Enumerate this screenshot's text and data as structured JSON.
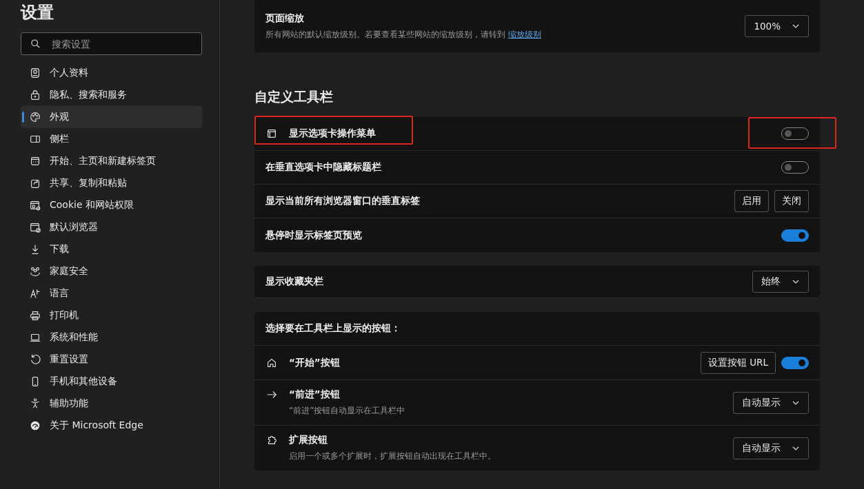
{
  "sidebar": {
    "title": "设置",
    "search": {
      "placeholder": "搜索设置"
    },
    "items": [
      {
        "label": "个人资料",
        "selected": false
      },
      {
        "label": "隐私、搜索和服务",
        "selected": false
      },
      {
        "label": "外观",
        "selected": true
      },
      {
        "label": "侧栏",
        "selected": false
      },
      {
        "label": "开始、主页和新建标签页",
        "selected": false
      },
      {
        "label": "共享、复制和粘贴",
        "selected": false
      },
      {
        "label": "Cookie 和网站权限",
        "selected": false
      },
      {
        "label": "默认浏览器",
        "selected": false
      },
      {
        "label": "下载",
        "selected": false
      },
      {
        "label": "家庭安全",
        "selected": false
      },
      {
        "label": "语言",
        "selected": false
      },
      {
        "label": "打印机",
        "selected": false
      },
      {
        "label": "系统和性能",
        "selected": false
      },
      {
        "label": "重置设置",
        "selected": false
      },
      {
        "label": "手机和其他设备",
        "selected": false
      },
      {
        "label": "辅助功能",
        "selected": false
      },
      {
        "label": "关于 Microsoft Edge",
        "selected": false
      }
    ]
  },
  "zoom_card": {
    "title": "页面缩放",
    "description": "所有网站的默认缩放级别。若要查看某些网站的缩放级别，请转到",
    "link": "缩放级别",
    "value": "100%"
  },
  "section_title": "自定义工具栏",
  "toolbar_card": [
    {
      "kind": "toggle",
      "label": "显示选项卡操作菜单",
      "on": false,
      "highlighted": true
    },
    {
      "kind": "toggle",
      "label": "在垂直选项卡中隐藏标题栏",
      "on": false,
      "highlighted": false
    },
    {
      "kind": "buttons",
      "label": "显示当前所有浏览器窗口的垂直标签",
      "buttons": [
        "启用",
        "关闭"
      ]
    },
    {
      "kind": "toggle",
      "label": "悬停时显示标签页预览",
      "on": true,
      "highlighted": false
    }
  ],
  "favorites_card": {
    "label": "显示收藏夹栏",
    "value": "始终"
  },
  "buttons_card": {
    "header": "选择要在工具栏上显示的按钮：",
    "rows": [
      {
        "kind": "toggle",
        "label": "“开始”按钮",
        "button": "设置按钮 URL",
        "on": true
      },
      {
        "kind": "select",
        "label": "“前进”按钮",
        "description": "“前进”按钮自动显示在工具栏中",
        "value": "自动显示"
      },
      {
        "kind": "select",
        "label": "扩展按钮",
        "description": "启用一个或多个扩展时，扩展按钮自动出现在工具栏中。",
        "value": "自动显示"
      }
    ]
  }
}
